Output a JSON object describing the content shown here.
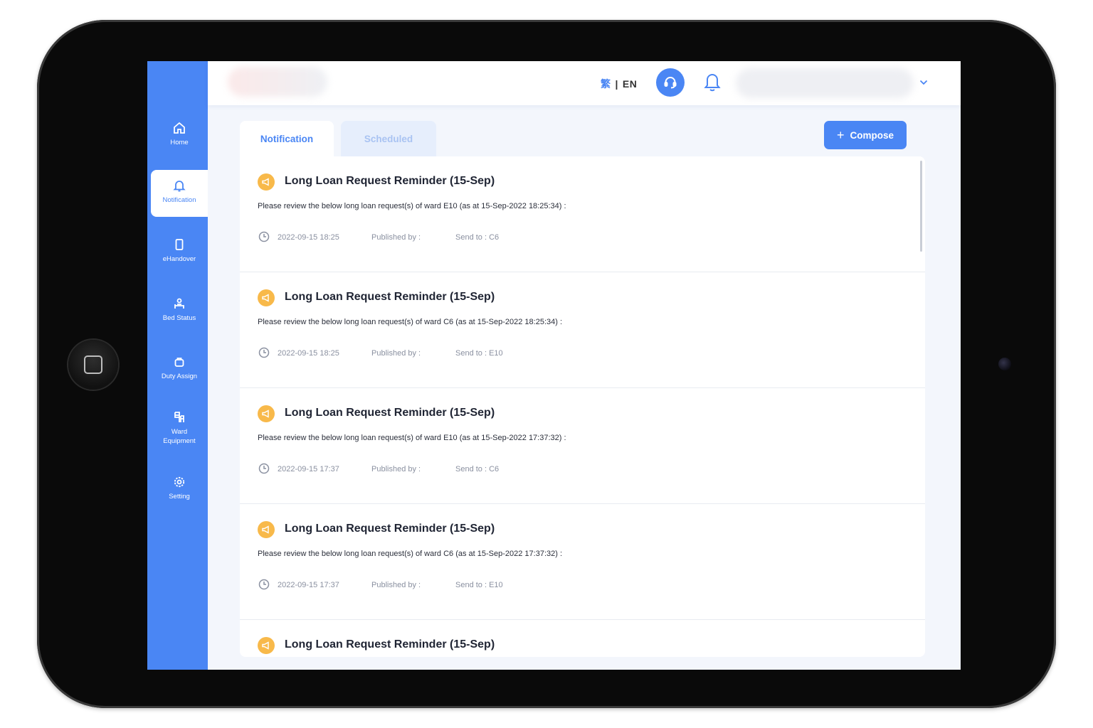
{
  "language": {
    "zh": "繁",
    "separator": "|",
    "en": "EN"
  },
  "sidebar": {
    "items": [
      {
        "label": "Home"
      },
      {
        "label": "Notification"
      },
      {
        "label": "eHandover"
      },
      {
        "label": "Bed Status"
      },
      {
        "label": "Duty Assign"
      },
      {
        "label": "Ward Equipment"
      },
      {
        "label": "Setting"
      }
    ]
  },
  "tabs": [
    {
      "label": "Notification"
    },
    {
      "label": "Scheduled"
    }
  ],
  "compose_label": "Compose",
  "notifications": [
    {
      "title": "Long Loan Request Reminder (15-Sep)",
      "message": "Please review the below long loan request(s) of ward E10 (as at 15-Sep-2022 18:25:34) :",
      "datetime": "2022-09-15 18:25",
      "published_by": "Published by :",
      "send_to": "Send to : C6"
    },
    {
      "title": "Long Loan Request Reminder (15-Sep)",
      "message": "Please review the below long loan request(s) of ward C6 (as at 15-Sep-2022 18:25:34) :",
      "datetime": "2022-09-15 18:25",
      "published_by": "Published by :",
      "send_to": "Send to : E10"
    },
    {
      "title": "Long Loan Request Reminder (15-Sep)",
      "message": "Please review the below long loan request(s) of ward E10 (as at 15-Sep-2022 17:37:32) :",
      "datetime": "2022-09-15 17:37",
      "published_by": "Published by :",
      "send_to": "Send to : C6"
    },
    {
      "title": "Long Loan Request Reminder (15-Sep)",
      "message": "Please review the below long loan request(s) of ward C6 (as at 15-Sep-2022 17:37:32) :",
      "datetime": "2022-09-15 17:37",
      "published_by": "Published by :",
      "send_to": "Send to : E10"
    },
    {
      "title": "Long Loan Request Reminder (15-Sep)"
    }
  ],
  "colors": {
    "primary": "#4a86f4",
    "badge": "#f8b94a",
    "background": "#f3f6fc"
  },
  "icons": [
    "home-icon",
    "bell-icon",
    "tablet-icon",
    "bed-icon",
    "briefcase-icon",
    "equipment-icon",
    "gear-icon",
    "headset-icon",
    "chevron-down-icon",
    "megaphone-icon",
    "clock-icon"
  ]
}
